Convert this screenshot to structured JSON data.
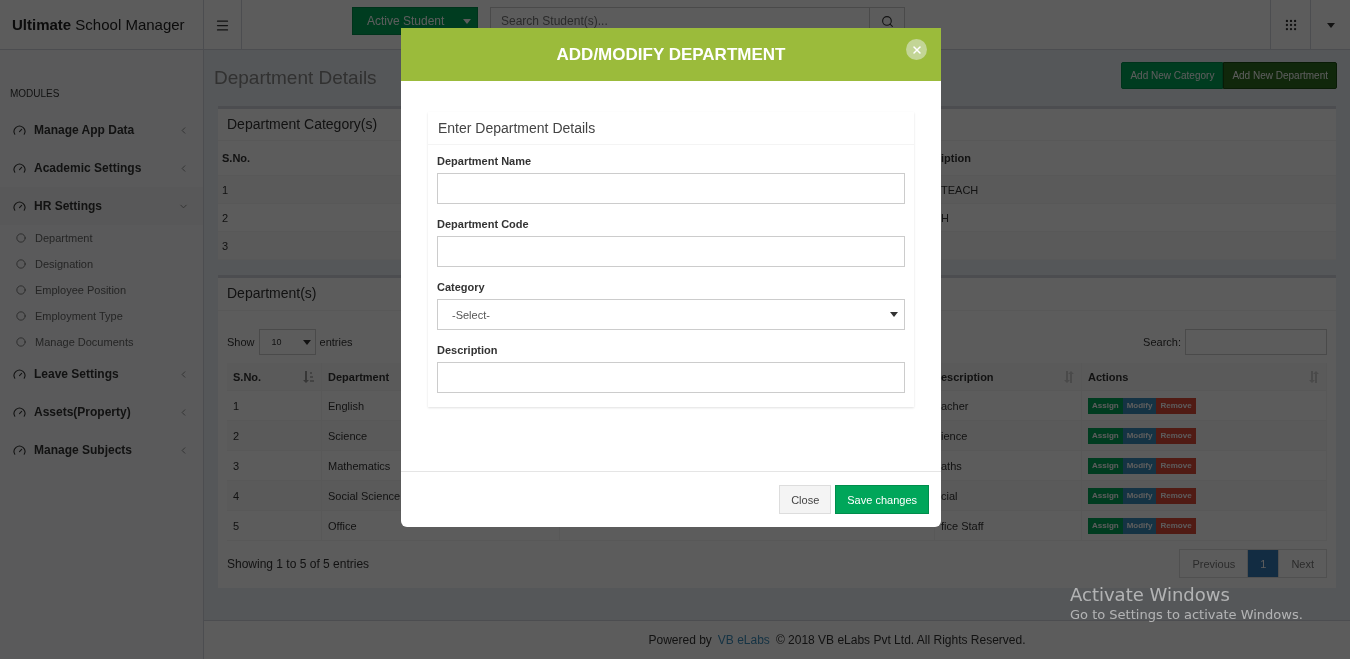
{
  "app": {
    "brand": "**Ultimate** School Manager"
  },
  "topbar": {
    "primary_button": "Active Student",
    "search": {
      "placeholder": "Search Student(s)..."
    }
  },
  "sidebar": {
    "heading": "MODULES",
    "items": [
      {
        "label": "Manage App Data",
        "expanded": false
      },
      {
        "label": "Academic Settings",
        "expanded": false
      },
      {
        "label": "HR Settings",
        "expanded": true,
        "children": [
          {
            "label": "Department"
          },
          {
            "label": "Designation"
          },
          {
            "label": "Employee Position"
          },
          {
            "label": "Employment Type"
          },
          {
            "label": "Manage Documents"
          }
        ]
      },
      {
        "label": "Leave Settings",
        "expanded": false
      },
      {
        "label": "Assets(Property)",
        "expanded": false
      },
      {
        "label": "Manage Subjects",
        "expanded": false
      }
    ]
  },
  "page": {
    "title": "Department Details",
    "buttons": [
      {
        "label": "Add New Category",
        "kind": "success"
      },
      {
        "label": "Add New Department",
        "kind": "dark"
      }
    ]
  },
  "category_panel": {
    "title": "Department Category(s)",
    "columns": [
      "S.No.",
      "iption"
    ],
    "rows": [
      {
        "sno": "1",
        "description": "TEACH"
      },
      {
        "sno": "2",
        "description": "H"
      },
      {
        "sno": "3"
      }
    ]
  },
  "department_panel": {
    "title": "Department(s)",
    "show_label": "Show",
    "length": "10",
    "entries_label": "entries",
    "search_label": "Search:",
    "columns": [
      {
        "label": "S.No.",
        "sorted": true
      },
      {
        "label": "Department"
      },
      {
        "label": "escription",
        "sorted": false
      },
      {
        "label": "Actions",
        "sorted": false
      }
    ],
    "rows": [
      {
        "sno": "1",
        "name": "English",
        "description": "acher",
        "actions": [
          {
            "label": "Assign",
            "kind": "success"
          },
          {
            "label": "Modify",
            "kind": "primary"
          },
          {
            "label": "Remove",
            "kind": "danger"
          }
        ]
      },
      {
        "sno": "2",
        "name": "Science",
        "description": "ience",
        "actions": [
          {
            "label": "Assign",
            "kind": "success"
          },
          {
            "label": "Modify",
            "kind": "primary"
          },
          {
            "label": "Remove",
            "kind": "danger"
          }
        ]
      },
      {
        "sno": "3",
        "name": "Mathematics",
        "description": "aths",
        "actions": [
          {
            "label": "Assign",
            "kind": "success"
          },
          {
            "label": "Modify",
            "kind": "primary"
          },
          {
            "label": "Remove",
            "kind": "danger"
          }
        ]
      },
      {
        "sno": "4",
        "name": "Social Science",
        "description": "cial",
        "actions": [
          {
            "label": "Assign",
            "kind": "success"
          },
          {
            "label": "Modify",
            "kind": "primary"
          },
          {
            "label": "Remove",
            "kind": "danger"
          }
        ]
      },
      {
        "sno": "5",
        "name": "Office",
        "description": "fice Staff",
        "actions": [
          {
            "label": "Assign",
            "kind": "success"
          },
          {
            "label": "Modify",
            "kind": "primary"
          },
          {
            "label": "Remove",
            "kind": "danger"
          }
        ]
      }
    ],
    "info": "Showing 1 to 5 of 5 entries",
    "pagination": [
      {
        "label": "Previous",
        "selected": false
      },
      {
        "label": "1",
        "selected": true
      },
      {
        "label": "Next",
        "selected": false
      }
    ]
  },
  "footer": {
    "prefix": "Powered by",
    "link": "VB eLabs",
    "text": "© 2018 VB eLabs Pvt Ltd. All Rights Reserved."
  },
  "modal": {
    "title": "ADD/MODIFY DEPARTMENT",
    "section_title": "Enter Department Details",
    "fields": [
      {
        "label": "Department Name",
        "kind": "text"
      },
      {
        "label": "Department Code",
        "kind": "text"
      },
      {
        "label": "Category",
        "kind": "select",
        "value": "-Select-"
      },
      {
        "label": "Description",
        "kind": "text"
      }
    ],
    "buttons": [
      {
        "label": "Close",
        "kind": "default"
      },
      {
        "label": "Save changes",
        "kind": "primary"
      }
    ]
  },
  "os_notice": {
    "title": "Activate Windows",
    "subtitle": "Go to Settings to activate Windows."
  }
}
